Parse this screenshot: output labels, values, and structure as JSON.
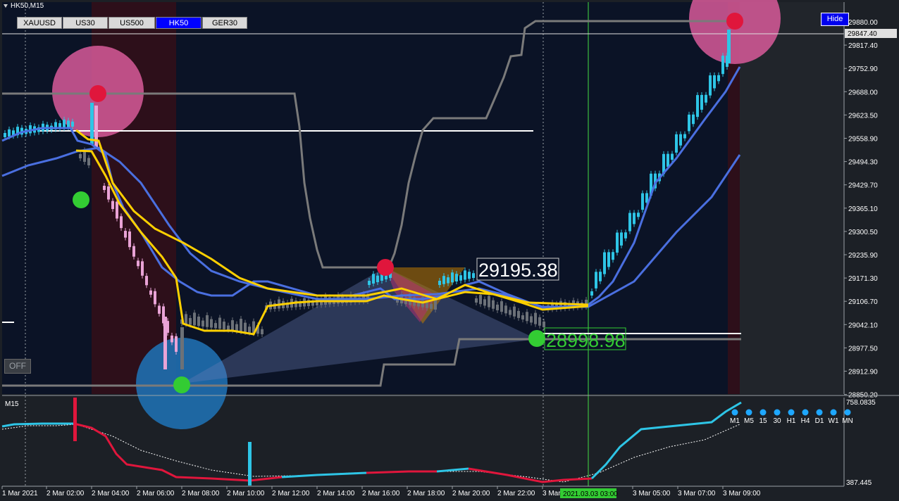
{
  "window": {
    "title": "HK50,M15"
  },
  "symbol_buttons": [
    {
      "label": "XAUUSD",
      "active": false
    },
    {
      "label": "US30",
      "active": false
    },
    {
      "label": "US500",
      "active": false
    },
    {
      "label": "HK50",
      "active": true
    },
    {
      "label": "GER30",
      "active": false
    }
  ],
  "hide_button": "Hide",
  "off_button": "OFF",
  "price_axis": [
    "29880.00",
    "29817.40",
    "29752.90",
    "29688.00",
    "29623.50",
    "29558.90",
    "29494.30",
    "29429.70",
    "29365.10",
    "29300.50",
    "29235.90",
    "29171.30",
    "29106.70",
    "29042.10",
    "28977.50",
    "28912.90",
    "28850.20"
  ],
  "current_price": "29847.40",
  "annotations": {
    "high_label": "29195.38",
    "low_label": "28998.98"
  },
  "time_axis": [
    "1 Mar 2021",
    "2 Mar 02:00",
    "2 Mar 04:00",
    "2 Mar 06:00",
    "2 Mar 08:00",
    "2 Mar 10:00",
    "2 Mar 12:00",
    "2 Mar 14:00",
    "2 Mar 16:00",
    "2 Mar 18:00",
    "2 Mar 20:00",
    "2 Mar 22:00",
    "3 Mar",
    "3 Mar 05:00",
    "3 Mar 07:00",
    "3 Mar 09:00"
  ],
  "time_highlight": "2021.03.03 03:00",
  "sub_window": {
    "label": "M15",
    "top_value": "758.0835",
    "bottom_value": "387.445",
    "timeframes": [
      "M1",
      "M5",
      "15",
      "30",
      "H1",
      "H4",
      "D1",
      "W1",
      "MN"
    ]
  },
  "colors": {
    "background": "#0b1326",
    "bull_candle": "#2ec5e6",
    "bear_candle_strong": "#e9a3d6",
    "neutral_candle": "#6c7178",
    "ma_yellow": "#ffd000",
    "ma_blue": "#4a6fe0",
    "channel_gray": "#7a7a7a",
    "dot_red": "#e0163c",
    "dot_green": "#33cc33",
    "highlight_pink": "#d85a9a",
    "highlight_blue": "#1f6fb0"
  }
}
